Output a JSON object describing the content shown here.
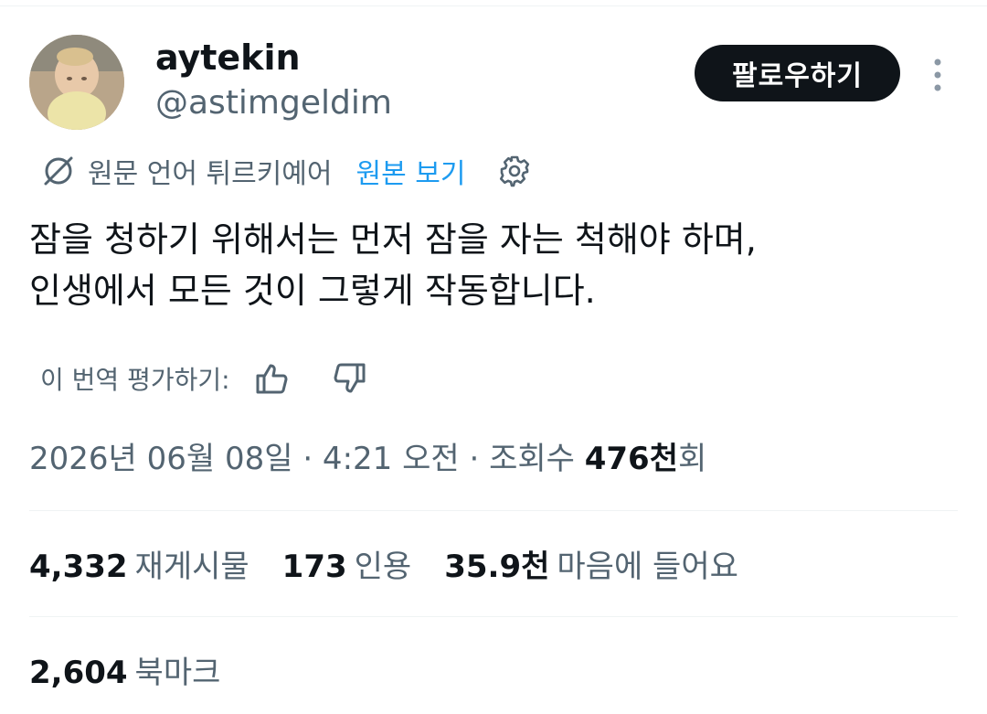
{
  "author": {
    "display_name": "aytekin",
    "handle": "@astimgeldim"
  },
  "follow_button": {
    "label": "팔로우하기"
  },
  "translation": {
    "source_text": "원문 언어 튀르키예어",
    "view_original_label": "원본 보기",
    "rate_label": "이 번역 평가하기:"
  },
  "tweet": {
    "lines": [
      "잠을 청하기 위해서는 먼저 잠을 자는 척해야 하며,",
      "인생에서 모든 것이 그렇게 작동합니다."
    ]
  },
  "meta": {
    "timestamp": "2026년 06월 08일 · 4:21 오전 · 조회수 ",
    "views_count": "476천",
    "views_suffix": "회"
  },
  "stats": {
    "retweets": {
      "count": "4,332",
      "label": "재게시물"
    },
    "quotes": {
      "count": "173",
      "label": "인용"
    },
    "likes": {
      "count": "35.9천",
      "label": "마음에 들어요"
    },
    "bookmarks": {
      "count": "2,604",
      "label": "북마크"
    }
  },
  "icons": {
    "more": "more-vertical-icon",
    "language": "translate-slash-icon",
    "settings": "gear-icon",
    "thumbs_up": "thumbs-up-icon",
    "thumbs_down": "thumbs-down-icon"
  },
  "colors": {
    "text_primary": "#0f1419",
    "text_secondary": "#536471",
    "link": "#1d9bf0",
    "button_bg": "#0f1419"
  }
}
